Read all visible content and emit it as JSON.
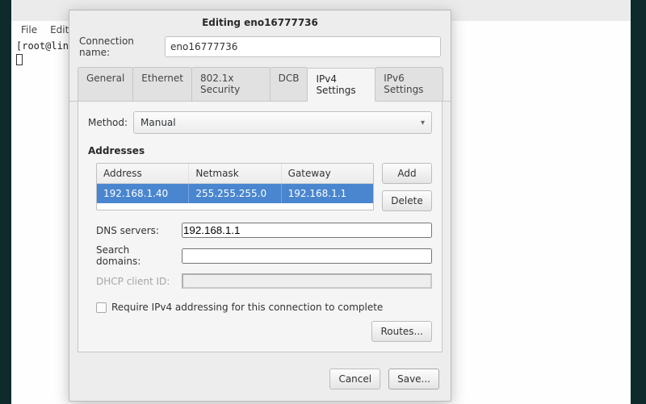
{
  "terminal": {
    "menus": [
      "File",
      "Edit"
    ],
    "prompt": "[root@lin"
  },
  "dialog": {
    "title": "Editing eno16777736",
    "conn_name_label": "Connection name:",
    "conn_name_value": "eno16777736",
    "tabs": [
      "General",
      "Ethernet",
      "802.1x Security",
      "DCB",
      "IPv4 Settings",
      "IPv6 Settings"
    ],
    "active_tab": "IPv4 Settings",
    "method_label": "Method:",
    "method": "Manual",
    "addresses_label": "Addresses",
    "addresses_cols": [
      "Address",
      "Netmask",
      "Gateway"
    ],
    "addresses_row": [
      "192.168.1.40",
      "255.255.255.0",
      "192.168.1.1"
    ],
    "add_button": "Add",
    "delete_button": "Delete",
    "dns_label": "DNS servers:",
    "dns_value": "192.168.1.1",
    "search_label": "Search domains:",
    "search_value": "",
    "dhcp_label": "DHCP client ID:",
    "dhcp_value": "",
    "require_label": "Require IPv4 addressing for this connection to complete",
    "routes_button": "Routes...",
    "cancel": "Cancel",
    "save": "Save..."
  }
}
